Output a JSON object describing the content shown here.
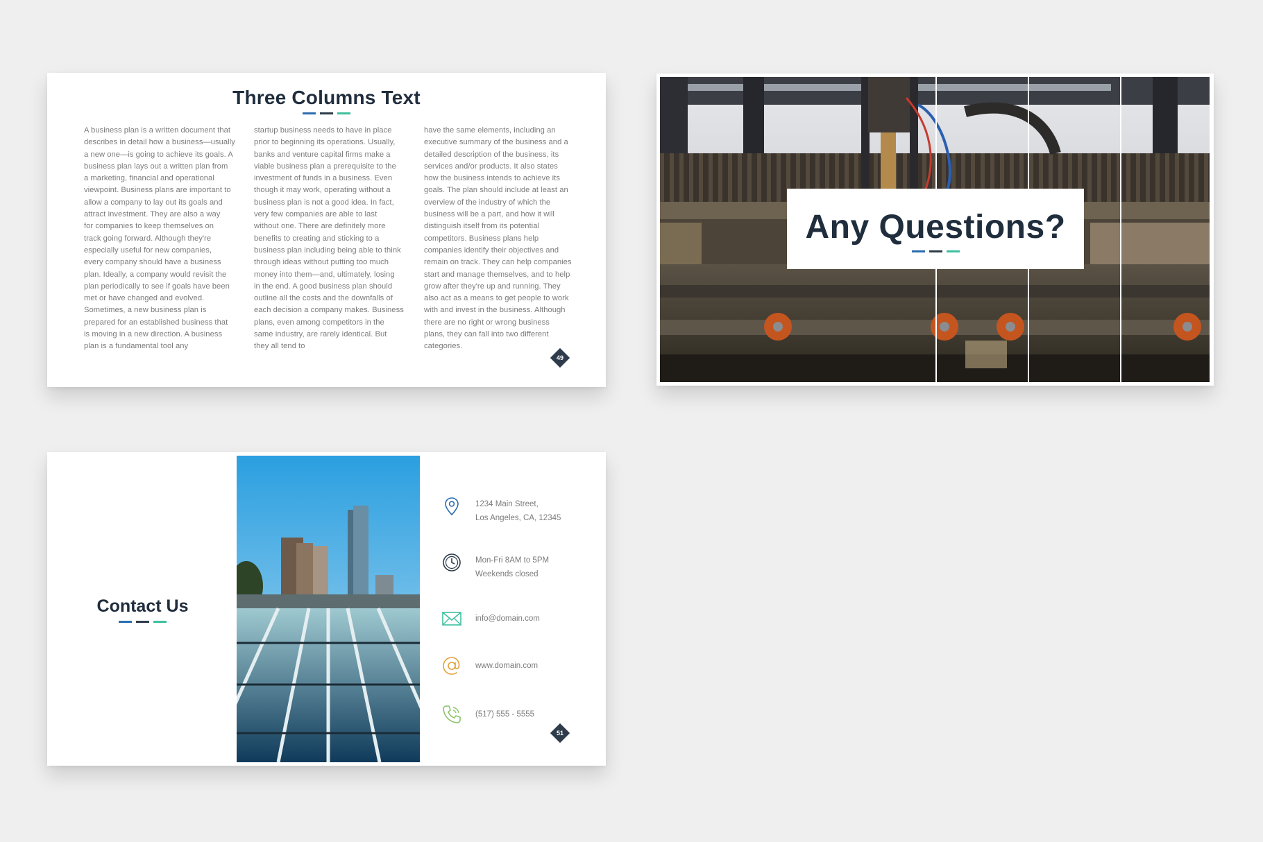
{
  "slides": {
    "columns": {
      "title": "Three Columns Text",
      "page_number": "49",
      "column1": [
        "A business plan is a written document that",
        "describes in detail how a business—usually",
        "a new one—is going to achieve its goals. A",
        "business plan lays out a written plan from",
        "a marketing, financial and operational",
        "viewpoint. Business plans are important to",
        "allow a company to lay out its goals and",
        "attract investment. They are also a way",
        "for companies to keep themselves on",
        "track going forward. Although they're",
        "especially useful for new companies,",
        "every company should have a business",
        "plan. Ideally, a company would revisit the",
        "plan periodically to see if goals have been",
        "met or have changed and evolved.",
        "Sometimes, a new business plan is",
        "prepared for an established business that",
        "is moving in a new direction. A business",
        "plan is a fundamental tool any"
      ],
      "column2": [
        "startup business needs to have in place",
        "prior to beginning its operations. Usually,",
        "banks and venture capital firms make a",
        "viable business plan a prerequisite to the",
        "investment of funds in a business. Even",
        "though it may work, operating without a",
        "business plan is not a good idea. In fact,",
        "very few companies are able to last",
        "without one. There are definitely more",
        "benefits to creating and sticking to a",
        "business plan including being able to think",
        "through ideas without putting too much",
        "money into them—and, ultimately, losing",
        "in the end. A good business plan should",
        "outline all the costs and the downfalls of",
        "each decision a company makes.  Business",
        "plans, even among competitors in the",
        "same industry, are rarely identical. But",
        "they all tend to"
      ],
      "column3": [
        "have the same elements, including an",
        "executive summary of the business and a",
        "detailed description of the business, its",
        "services and/or products. It also states",
        "how the business intends to achieve its",
        "goals. The plan should include at least an",
        "overview of the industry of which the",
        "business will be a part, and how it will",
        "distinguish itself from its potential",
        "competitors. Business plans help",
        "companies identify their objectives and",
        "remain on track. They can help companies",
        "start and manage themselves, and to help",
        "grow after they're up and running. They",
        "also act as a means to get people to work",
        "with and invest in the business. Although",
        "there are no right or wrong business",
        "plans, they can fall into two different",
        "categories."
      ]
    },
    "questions": {
      "title": "Any Questions?"
    },
    "contact": {
      "title": "Contact Us",
      "page_number": "51",
      "address_line1": "1234 Main Street,",
      "address_line2": "Los Angeles, CA, 12345",
      "hours_line1": "Mon-Fri 8AM to 5PM",
      "hours_line2": "Weekends closed",
      "email": "info@domain.com",
      "website": "www.domain.com",
      "phone": "(517) 555 - 5555"
    }
  },
  "colors": {
    "accent_blue": "#2b6cb0",
    "accent_dark": "#2e3b4a",
    "accent_teal": "#3dbf9f",
    "title": "#1f2d3d",
    "body_text": "#7b7b7b",
    "background": "#efefef",
    "icon_location": "#2b6cb0",
    "icon_clock": "#2e3b4a",
    "icon_mail": "#3dbf9f",
    "icon_at": "#e2a13a",
    "icon_phone": "#8cc46a"
  },
  "icons": [
    "map-pin-icon",
    "clock-icon",
    "mail-icon",
    "at-icon",
    "phone-icon"
  ]
}
